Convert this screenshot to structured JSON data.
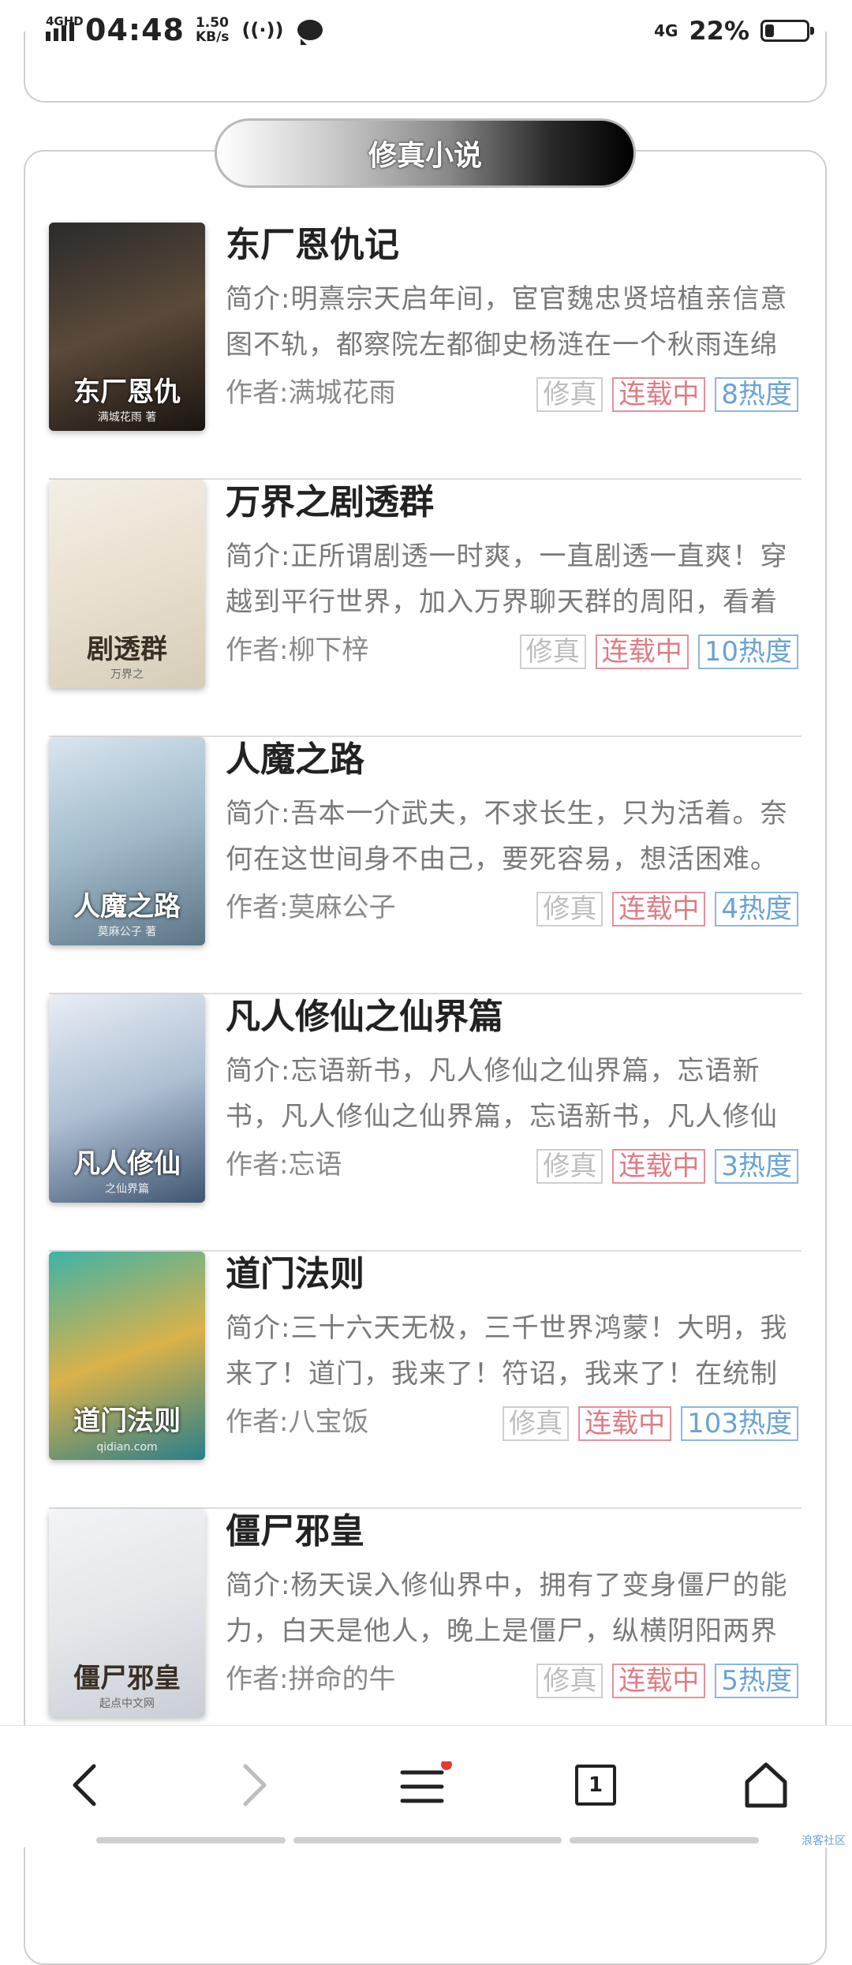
{
  "status_bar": {
    "network": "4GHD",
    "time": "04:48",
    "speed_value": "1.50",
    "speed_unit": "KB/s",
    "net_type": "4G",
    "battery_pct": "22%",
    "battery_level": 0.22
  },
  "section": {
    "title": "修真小说"
  },
  "books": [
    {
      "title": "东厂恩仇记",
      "desc": "简介:明熹宗天启年间，宦官魏忠贤培植亲信意图不轨，都察院左都御史杨涟在一个秋雨连绵",
      "author": "作者:满城花雨",
      "tag_genre": "修真",
      "tag_status": "连载中",
      "tag_heat": "8热度",
      "cover_text": "东厂恩仇",
      "cover_sub": "满城花雨 著",
      "cover_colors": [
        "#2b2a2a",
        "#5a4a3a",
        "#1a1410"
      ]
    },
    {
      "title": "万界之剧透群",
      "desc": "简介:正所谓剧透一时爽，一直剧透一直爽！穿越到平行世界，加入万界聊天群的周阳，看着",
      "author": "作者:柳下梓",
      "tag_genre": "修真",
      "tag_status": "连载中",
      "tag_heat": "10热度",
      "cover_text": "剧透群",
      "cover_sub": "万界之",
      "cover_colors": [
        "#f4efe6",
        "#e8e0d0",
        "#d6cdb8"
      ]
    },
    {
      "title": "人魔之路",
      "desc": "简介:吾本一介武夫，不求长生，只为活着。奈何在这世间身不由己，要死容易，想活困难。",
      "author": "作者:莫麻公子",
      "tag_genre": "修真",
      "tag_status": "连载中",
      "tag_heat": "4热度",
      "cover_text": "人魔之路",
      "cover_sub": "莫麻公子 著",
      "cover_colors": [
        "#d9e6ef",
        "#9fb9c9",
        "#5b7486"
      ]
    },
    {
      "title": "凡人修仙之仙界篇",
      "desc": "简介:忘语新书，凡人修仙之仙界篇，忘语新书，凡人修仙之仙界篇，忘语新书，凡人修仙",
      "author": "作者:忘语",
      "tag_genre": "修真",
      "tag_status": "连载中",
      "tag_heat": "3热度",
      "cover_text": "凡人修仙",
      "cover_sub": "之仙界篇",
      "cover_colors": [
        "#e9eef5",
        "#aebfd3",
        "#3f5570"
      ]
    },
    {
      "title": "道门法则",
      "desc": "简介:三十六天无极，三千世界鸿蒙！大明，我来了！道门，我来了！符诏，我来了！在统制",
      "author": "作者:八宝饭",
      "tag_genre": "修真",
      "tag_status": "连载中",
      "tag_heat": "103热度",
      "cover_text": "道门法则",
      "cover_sub": "qidian.com",
      "cover_colors": [
        "#3fb3a6",
        "#d9b24a",
        "#2a7f8a"
      ]
    },
    {
      "title": "僵尸邪皇",
      "desc": "简介:杨天误入修仙界中，拥有了变身僵尸的能力，白天是他人，晚上是僵尸，纵横阴阳两界",
      "author": "作者:拼命的牛",
      "tag_genre": "修真",
      "tag_status": "连载中",
      "tag_heat": "5热度",
      "cover_text": "僵尸邪皇",
      "cover_sub": "起点中文网",
      "cover_colors": [
        "#f3f4f6",
        "#e3e6ea",
        "#c9ced6"
      ]
    }
  ],
  "nav": {
    "tabs_count": "1"
  },
  "watermark": "浪客社区"
}
